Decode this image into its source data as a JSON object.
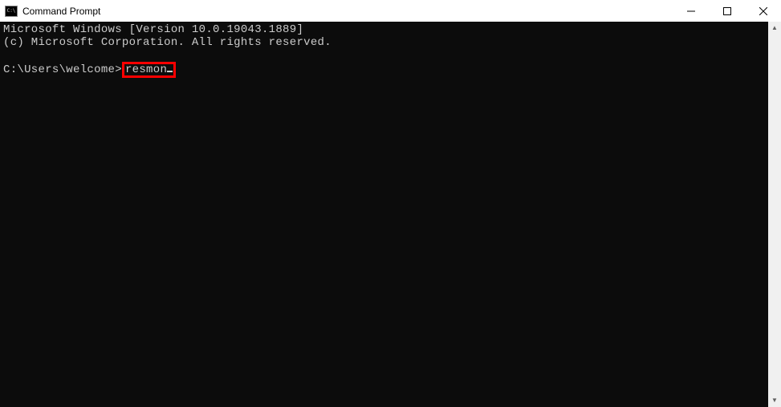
{
  "window": {
    "title": "Command Prompt",
    "icon_label": "C:\\"
  },
  "terminal": {
    "line1": "Microsoft Windows [Version 10.0.19043.1889]",
    "line2": "(c) Microsoft Corporation. All rights reserved.",
    "prompt": "C:\\Users\\welcome>",
    "command": "resmon"
  }
}
